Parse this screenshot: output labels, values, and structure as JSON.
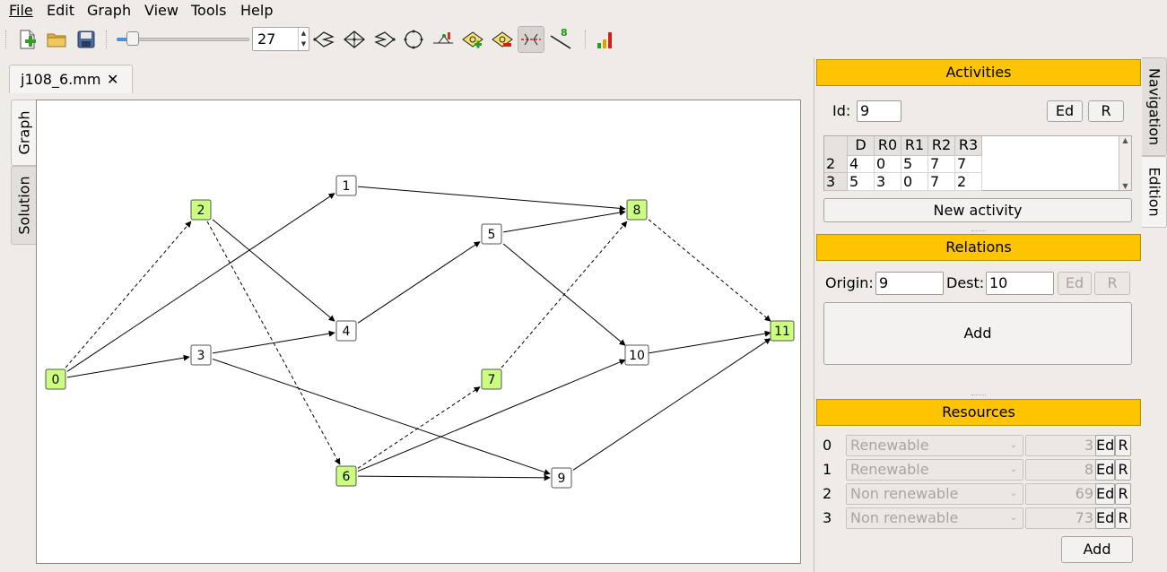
{
  "menu": [
    "File",
    "Edit",
    "Graph",
    "View",
    "Tools",
    "Help"
  ],
  "toolbar": {
    "zoom_value": "27",
    "active_tool": "critical-path-tool",
    "tool_badge": "8"
  },
  "document_tab": {
    "label": "j108_6.mm",
    "close": "✕"
  },
  "left_tabs": [
    "Graph",
    "Solution"
  ],
  "right_tabs": [
    "Navigation",
    "Edition"
  ],
  "graph": {
    "highlight_color": "#ccff80",
    "nodes": [
      {
        "id": "0",
        "highlight": true
      },
      {
        "id": "1",
        "highlight": false
      },
      {
        "id": "2",
        "highlight": true
      },
      {
        "id": "3",
        "highlight": false
      },
      {
        "id": "4",
        "highlight": false
      },
      {
        "id": "5",
        "highlight": false
      },
      {
        "id": "6",
        "highlight": true
      },
      {
        "id": "7",
        "highlight": true
      },
      {
        "id": "8",
        "highlight": true
      },
      {
        "id": "9",
        "highlight": false
      },
      {
        "id": "10",
        "highlight": false
      },
      {
        "id": "11",
        "highlight": true
      }
    ],
    "edges": [
      {
        "from": "0",
        "to": "2",
        "dashed": true
      },
      {
        "from": "0",
        "to": "1",
        "dashed": false
      },
      {
        "from": "0",
        "to": "3",
        "dashed": false
      },
      {
        "from": "1",
        "to": "8",
        "dashed": false
      },
      {
        "from": "2",
        "to": "4",
        "dashed": false
      },
      {
        "from": "2",
        "to": "6",
        "dashed": true
      },
      {
        "from": "3",
        "to": "4",
        "dashed": false
      },
      {
        "from": "3",
        "to": "9",
        "dashed": false
      },
      {
        "from": "4",
        "to": "5",
        "dashed": false
      },
      {
        "from": "5",
        "to": "8",
        "dashed": false
      },
      {
        "from": "5",
        "to": "10",
        "dashed": false
      },
      {
        "from": "6",
        "to": "7",
        "dashed": true
      },
      {
        "from": "6",
        "to": "10",
        "dashed": false
      },
      {
        "from": "6",
        "to": "9",
        "dashed": false
      },
      {
        "from": "7",
        "to": "8",
        "dashed": true
      },
      {
        "from": "8",
        "to": "11",
        "dashed": true
      },
      {
        "from": "10",
        "to": "11",
        "dashed": false
      },
      {
        "from": "9",
        "to": "11",
        "dashed": false
      }
    ]
  },
  "activities": {
    "header": "Activities",
    "id_label": "Id:",
    "id_value": "9",
    "ed_label": "Ed",
    "r_label": "R",
    "columns": [
      "D",
      "R0",
      "R1",
      "R2",
      "R3"
    ],
    "rows": [
      {
        "id": "2",
        "cells": [
          "4",
          "0",
          "5",
          "7",
          "7"
        ]
      },
      {
        "id": "3",
        "cells": [
          "5",
          "3",
          "0",
          "7",
          "2"
        ]
      }
    ],
    "new_button": "New activity"
  },
  "relations": {
    "header": "Relations",
    "origin_label": "Origin:",
    "origin_value": "9",
    "dest_label": "Dest:",
    "dest_value": "10",
    "ed_label": "Ed",
    "r_label": "R",
    "add_button": "Add"
  },
  "resources": {
    "header": "Resources",
    "items": [
      {
        "index": "0",
        "type": "Renewable",
        "value": "3"
      },
      {
        "index": "1",
        "type": "Renewable",
        "value": "8"
      },
      {
        "index": "2",
        "type": "Non renewable",
        "value": "69"
      },
      {
        "index": "3",
        "type": "Non renewable",
        "value": "73"
      }
    ],
    "ed_label": "Ed",
    "r_label": "R",
    "add_button": "Add"
  },
  "colors": {
    "section_header": "#ffc400",
    "node_highlight": "#ccff80"
  }
}
